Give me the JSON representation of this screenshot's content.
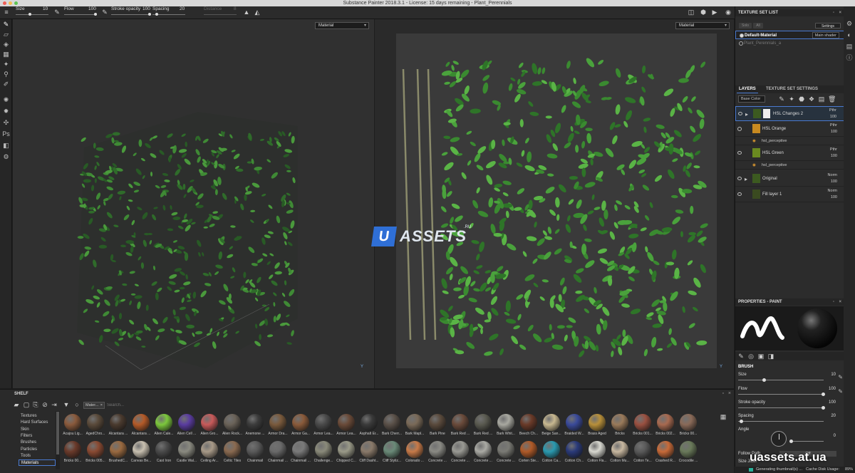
{
  "window": {
    "title": "Substance Painter 2018.3.1 - License: 15 days remaining - Plant_Perennials"
  },
  "toolbar": {
    "size_label": "Size",
    "size_value": "10",
    "flow_label": "Flow",
    "flow_value": "100",
    "stroke_label": "Stroke opacity",
    "stroke_value": "100",
    "spacing_label": "Spacing",
    "spacing_value": "20",
    "distance_label": "Distance",
    "distance_value": "8"
  },
  "viewport3d": {
    "mode": "Material",
    "axis": "Y"
  },
  "viewport2d": {
    "mode": "Material",
    "axis": "Y"
  },
  "watermark": {
    "letter": "U",
    "text": "ASSETS",
    "suffix": ".RU"
  },
  "texture_set_list": {
    "title": "TEXTURE SET LIST",
    "solo": "Solo",
    "all": "All",
    "settings": "Settings",
    "items": [
      {
        "name": "Default-Material",
        "shader": "Main shader"
      },
      {
        "name": "Plant_Perennials_a"
      }
    ]
  },
  "tabs": {
    "layers": "LAYERS",
    "tss": "TEXTURE SET SETTINGS"
  },
  "layers": {
    "channel": "Base Color",
    "items": [
      {
        "name": "HSL Changes 2",
        "blend": "Pthr",
        "opacity": "100"
      },
      {
        "name": "HSL Orange",
        "blend": "Pthr",
        "opacity": "100"
      },
      {
        "name": "hsl_perceptive"
      },
      {
        "name": "HSL Green",
        "blend": "Pthr",
        "opacity": "100"
      },
      {
        "name": "hsl_perceptive"
      },
      {
        "name": "Original",
        "blend": "Norm",
        "opacity": "100"
      },
      {
        "name": "Fill layer 1",
        "blend": "Norm",
        "opacity": "100"
      }
    ]
  },
  "properties": {
    "title": "PROPERTIES - PAINT",
    "brush": "BRUSH",
    "size_label": "Size",
    "size_value": "10",
    "flow_label": "Flow",
    "flow_value": "100",
    "stroke_label": "Stroke opacity",
    "stroke_value": "100",
    "spacing_label": "Spacing",
    "spacing_value": "20",
    "angle_label": "Angle",
    "angle_value": "0",
    "follow_label": "Follow Path",
    "follow_value": "Off",
    "jitter_label": "Size Jitter"
  },
  "shelf": {
    "title": "SHELF",
    "filter_tag": "Mater...",
    "search_placeholder": "Search...",
    "categories": [
      "Textures",
      "Hard Surfaces",
      "Skin",
      "Filters",
      "Brushes",
      "Particles",
      "Tools",
      "Materials"
    ],
    "materials_row1": [
      "Acajou Lig...",
      "AgedChro...",
      "Alcantara ...",
      "Alcantara ...",
      "Alien Cale...",
      "Alien Cell ...",
      "Alien Gro...",
      "Alien Rock...",
      "Anemone ...",
      "Armor Dra...",
      "Armor Ga...",
      "Armor Lea...",
      "Armor Lea...",
      "Asphalt Er...",
      "Bark Cherr...",
      "Bark Mapl...",
      "Bark Pine",
      "Bark Red ...",
      "Bark Red ...",
      "Bark Whit...",
      "Beech Ch...",
      "Beige San...",
      "Braided W...",
      "Brass Aged",
      "Bricks",
      "Bricks 001...",
      "Bricks 002...",
      "Bricks 00..."
    ],
    "materials_row2": [
      "Bricks 00...",
      "Bricks 005...",
      "BrushedC...",
      "Canvas Be...",
      "Cast Iron",
      "Castle Wal...",
      "Ceiling Ar...",
      "Celtic Tiles",
      "Chainmail",
      "Chainmail ...",
      "Chainmail ...",
      "Challenge...",
      "Chipped C...",
      "Cliff Dasht...",
      "Cliff Styliz...",
      "Colorado ...",
      "Concrete ...",
      "Concrete ...",
      "Concrete ...",
      "Concrete ...",
      "Corten Ste...",
      "Cotton Ca...",
      "Cotton Ch...",
      "Cotton Fla...",
      "Cotton Mu...",
      "Cotton Te...",
      "Crashed R...",
      "Crocodile ..."
    ],
    "colors_row1": [
      "#8a5a3c",
      "#5a4a3a",
      "#4a3a2e",
      "#b45a28",
      "#7cc83c",
      "#5a3ca0",
      "#c85a5a",
      "#6a6258",
      "#3c3c3c",
      "#7a5a3c",
      "#8a5a3a",
      "#4a4a4a",
      "#6a4a38",
      "#3a3a3a",
      "#5a5048",
      "#7a6a58",
      "#5a4a3c",
      "#6a4a3a",
      "#5a5a50",
      "#a8a8a0",
      "#6a3a28",
      "#c8b890",
      "#3a4a9a",
      "#b8903a",
      "#9a7a5a",
      "#9a5040",
      "#a86a50",
      "#8a6a58"
    ],
    "colors_row2": [
      "#6a3a2a",
      "#8a4a32",
      "#9a6a40",
      "#c8c0b0",
      "#4a4a4a",
      "#8a8a80",
      "#a89a88",
      "#8a6a50",
      "#5a5a5a",
      "#6a6a6a",
      "#7a7a7a",
      "#8a8a7a",
      "#9a9a88",
      "#8a7a6a",
      "#6a8a78",
      "#c87a48",
      "#8a8a84",
      "#9a9a94",
      "#aaaaa4",
      "#7a7a74",
      "#b05a28",
      "#2a9ab0",
      "#2a3a7a",
      "#d8d8d0",
      "#c8b8a0",
      "#5a5a5a",
      "#c86a38",
      "#6a7a5a"
    ]
  },
  "status": {
    "text": "Generating thumbnail(s) ...",
    "cache": "Cache Disk Usage:",
    "cache_value": "89%"
  },
  "site_watermark": "uassets.at.ua"
}
